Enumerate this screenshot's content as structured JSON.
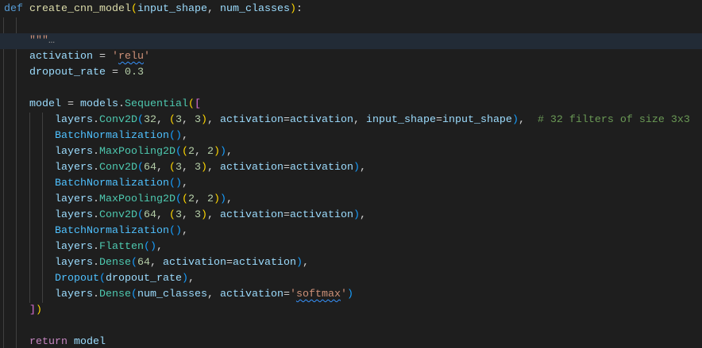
{
  "editor": {
    "highlighted_line": 2,
    "lines": [
      [
        [
          "def",
          "kw"
        ],
        [
          " ",
          "op"
        ],
        [
          "create_cnn_model",
          "fn"
        ],
        [
          "(",
          "b1"
        ],
        [
          "input_shape",
          "pa"
        ],
        [
          ", ",
          "op"
        ],
        [
          "num_classes",
          "pa"
        ],
        [
          ")",
          "b1"
        ],
        [
          ":",
          "op"
        ]
      ],
      [],
      [
        [
          "    ",
          "op"
        ],
        [
          "\"\"\"",
          "str"
        ],
        [
          "…",
          "fold"
        ]
      ],
      [
        [
          "    ",
          "op"
        ],
        [
          "activation",
          "pa"
        ],
        [
          " = ",
          "op"
        ],
        [
          "'",
          "str"
        ],
        [
          "relu",
          "str sq"
        ],
        [
          "'",
          "str"
        ]
      ],
      [
        [
          "    ",
          "op"
        ],
        [
          "dropout_rate",
          "pa"
        ],
        [
          " = ",
          "op"
        ],
        [
          "0.3",
          "num"
        ]
      ],
      [],
      [
        [
          "    ",
          "op"
        ],
        [
          "model",
          "pa"
        ],
        [
          " = ",
          "op"
        ],
        [
          "models",
          "pa"
        ],
        [
          ".",
          "op"
        ],
        [
          "Sequential",
          "cls"
        ],
        [
          "(",
          "b1"
        ],
        [
          "[",
          "b2"
        ]
      ],
      [
        [
          "        ",
          "op"
        ],
        [
          "layers",
          "pa"
        ],
        [
          ".",
          "op"
        ],
        [
          "Conv2D",
          "cls"
        ],
        [
          "(",
          "b3"
        ],
        [
          "32",
          "num"
        ],
        [
          ", ",
          "op"
        ],
        [
          "(",
          "b1"
        ],
        [
          "3",
          "num"
        ],
        [
          ", ",
          "op"
        ],
        [
          "3",
          "num"
        ],
        [
          ")",
          "b1"
        ],
        [
          ", ",
          "op"
        ],
        [
          "activation",
          "pa"
        ],
        [
          "=",
          "op"
        ],
        [
          "activation",
          "pa"
        ],
        [
          ", ",
          "op"
        ],
        [
          "input_shape",
          "pa"
        ],
        [
          "=",
          "op"
        ],
        [
          "input_shape",
          "pa"
        ],
        [
          ")",
          "b3"
        ],
        [
          ",  ",
          "op"
        ],
        [
          "# 32 filters of size 3x3",
          "cm"
        ]
      ],
      [
        [
          "        ",
          "op"
        ],
        [
          "BatchNormalization",
          "var2"
        ],
        [
          "()",
          "b3"
        ],
        [
          ",",
          "op"
        ]
      ],
      [
        [
          "        ",
          "op"
        ],
        [
          "layers",
          "pa"
        ],
        [
          ".",
          "op"
        ],
        [
          "MaxPooling2D",
          "cls"
        ],
        [
          "(",
          "b3"
        ],
        [
          "(",
          "b1"
        ],
        [
          "2",
          "num"
        ],
        [
          ", ",
          "op"
        ],
        [
          "2",
          "num"
        ],
        [
          ")",
          "b1"
        ],
        [
          ")",
          "b3"
        ],
        [
          ",",
          "op"
        ]
      ],
      [
        [
          "        ",
          "op"
        ],
        [
          "layers",
          "pa"
        ],
        [
          ".",
          "op"
        ],
        [
          "Conv2D",
          "cls"
        ],
        [
          "(",
          "b3"
        ],
        [
          "64",
          "num"
        ],
        [
          ", ",
          "op"
        ],
        [
          "(",
          "b1"
        ],
        [
          "3",
          "num"
        ],
        [
          ", ",
          "op"
        ],
        [
          "3",
          "num"
        ],
        [
          ")",
          "b1"
        ],
        [
          ", ",
          "op"
        ],
        [
          "activation",
          "pa"
        ],
        [
          "=",
          "op"
        ],
        [
          "activation",
          "pa"
        ],
        [
          ")",
          "b3"
        ],
        [
          ",",
          "op"
        ]
      ],
      [
        [
          "        ",
          "op"
        ],
        [
          "BatchNormalization",
          "var2"
        ],
        [
          "()",
          "b3"
        ],
        [
          ",",
          "op"
        ]
      ],
      [
        [
          "        ",
          "op"
        ],
        [
          "layers",
          "pa"
        ],
        [
          ".",
          "op"
        ],
        [
          "MaxPooling2D",
          "cls"
        ],
        [
          "(",
          "b3"
        ],
        [
          "(",
          "b1"
        ],
        [
          "2",
          "num"
        ],
        [
          ", ",
          "op"
        ],
        [
          "2",
          "num"
        ],
        [
          ")",
          "b1"
        ],
        [
          ")",
          "b3"
        ],
        [
          ",",
          "op"
        ]
      ],
      [
        [
          "        ",
          "op"
        ],
        [
          "layers",
          "pa"
        ],
        [
          ".",
          "op"
        ],
        [
          "Conv2D",
          "cls"
        ],
        [
          "(",
          "b3"
        ],
        [
          "64",
          "num"
        ],
        [
          ", ",
          "op"
        ],
        [
          "(",
          "b1"
        ],
        [
          "3",
          "num"
        ],
        [
          ", ",
          "op"
        ],
        [
          "3",
          "num"
        ],
        [
          ")",
          "b1"
        ],
        [
          ", ",
          "op"
        ],
        [
          "activation",
          "pa"
        ],
        [
          "=",
          "op"
        ],
        [
          "activation",
          "pa"
        ],
        [
          ")",
          "b3"
        ],
        [
          ",",
          "op"
        ]
      ],
      [
        [
          "        ",
          "op"
        ],
        [
          "BatchNormalization",
          "var2"
        ],
        [
          "()",
          "b3"
        ],
        [
          ",",
          "op"
        ]
      ],
      [
        [
          "        ",
          "op"
        ],
        [
          "layers",
          "pa"
        ],
        [
          ".",
          "op"
        ],
        [
          "Flatten",
          "cls"
        ],
        [
          "()",
          "b3"
        ],
        [
          ",",
          "op"
        ]
      ],
      [
        [
          "        ",
          "op"
        ],
        [
          "layers",
          "pa"
        ],
        [
          ".",
          "op"
        ],
        [
          "Dense",
          "cls"
        ],
        [
          "(",
          "b3"
        ],
        [
          "64",
          "num"
        ],
        [
          ", ",
          "op"
        ],
        [
          "activation",
          "pa"
        ],
        [
          "=",
          "op"
        ],
        [
          "activation",
          "pa"
        ],
        [
          ")",
          "b3"
        ],
        [
          ",",
          "op"
        ]
      ],
      [
        [
          "        ",
          "op"
        ],
        [
          "Dropout",
          "var2"
        ],
        [
          "(",
          "b3"
        ],
        [
          "dropout_rate",
          "pa"
        ],
        [
          ")",
          "b3"
        ],
        [
          ",",
          "op"
        ]
      ],
      [
        [
          "        ",
          "op"
        ],
        [
          "layers",
          "pa"
        ],
        [
          ".",
          "op"
        ],
        [
          "Dense",
          "cls"
        ],
        [
          "(",
          "b3"
        ],
        [
          "num_classes",
          "pa"
        ],
        [
          ", ",
          "op"
        ],
        [
          "activation",
          "pa"
        ],
        [
          "=",
          "op"
        ],
        [
          "'",
          "str"
        ],
        [
          "softmax",
          "str sq"
        ],
        [
          "'",
          "str"
        ],
        [
          ")",
          "b3"
        ]
      ],
      [
        [
          "    ",
          "op"
        ],
        [
          "]",
          "b2"
        ],
        [
          ")",
          "b1"
        ]
      ],
      [],
      [
        [
          "    ",
          "op"
        ],
        [
          "return",
          "ctl"
        ],
        [
          " ",
          "op"
        ],
        [
          "model",
          "pa"
        ]
      ]
    ]
  }
}
